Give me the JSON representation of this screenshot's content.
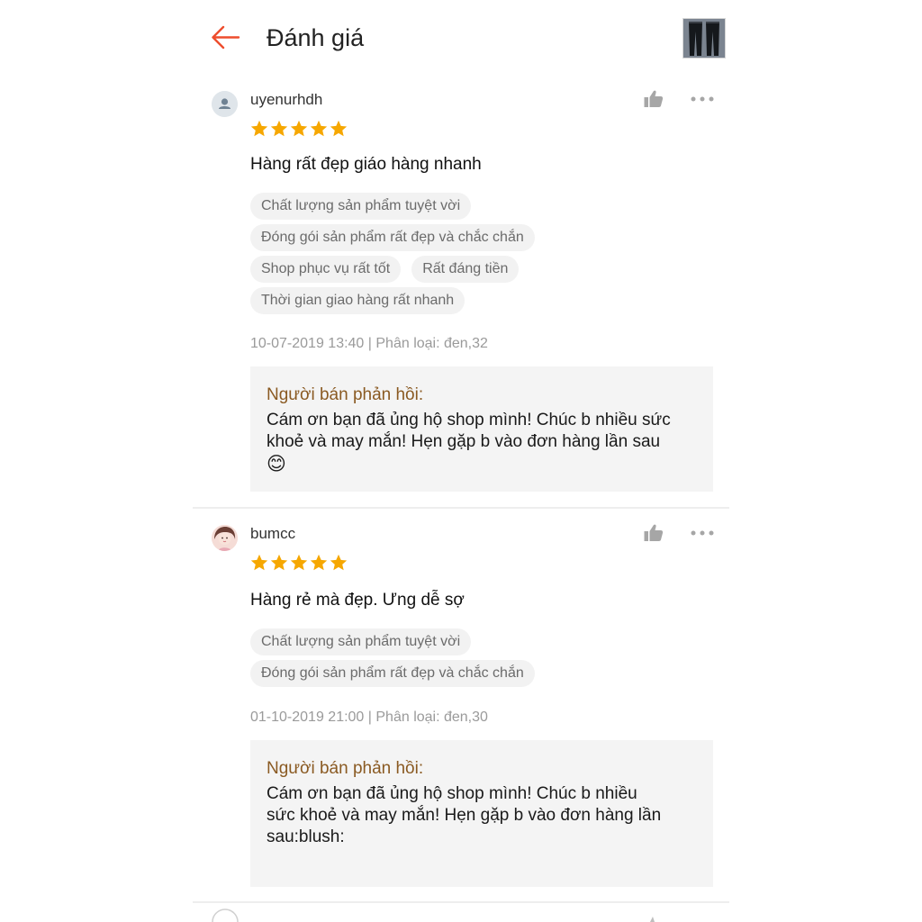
{
  "header": {
    "title": "Đánh giá",
    "back_icon": "arrow-left-icon",
    "accent_color": "#ee4d2d"
  },
  "reviews": [
    {
      "username": "uyenurhdh",
      "rating": 5,
      "comment": "Hàng rất đẹp giáo hàng nhanh",
      "tags": [
        "Chất lượng sản phẩm tuyệt vời",
        "Đóng gói sản phẩm rất đẹp và chắc chắn",
        "Shop phục vụ rất tốt",
        "Rất đáng tiền",
        "Thời gian giao hàng rất nhanh"
      ],
      "meta": "10-07-2019 13:40 | Phân loại: đen,32",
      "reply_label": "Người bán phản hồi:",
      "reply_text": " Cám ơn bạn đã ủng hộ shop mình! Chúc b nhiều sức khoẻ và may mắn! Hẹn gặp b vào đơn hàng lần sau",
      "reply_emoji": "😊"
    },
    {
      "username": "bumcc",
      "rating": 5,
      "comment": "Hàng rẻ mà đẹp. Ưng dễ sợ",
      "tags": [
        "Chất lượng sản phẩm tuyệt vời",
        "Đóng gói sản phẩm rất đẹp và chắc chắn"
      ],
      "meta": "01-10-2019 21:00 | Phân loại: đen,30",
      "reply_label": "Người bán phản hồi:",
      "reply_text": "Cám ơn bạn đã ủng hộ shop mình! Chúc b nhiều sức khoẻ và may mắn! Hẹn gặp b vào đơn hàng lần sau:blush:"
    }
  ],
  "colors": {
    "star": "#f6a700",
    "reply_label": "#8a5a22",
    "icon_gray": "#a6a6a6"
  }
}
